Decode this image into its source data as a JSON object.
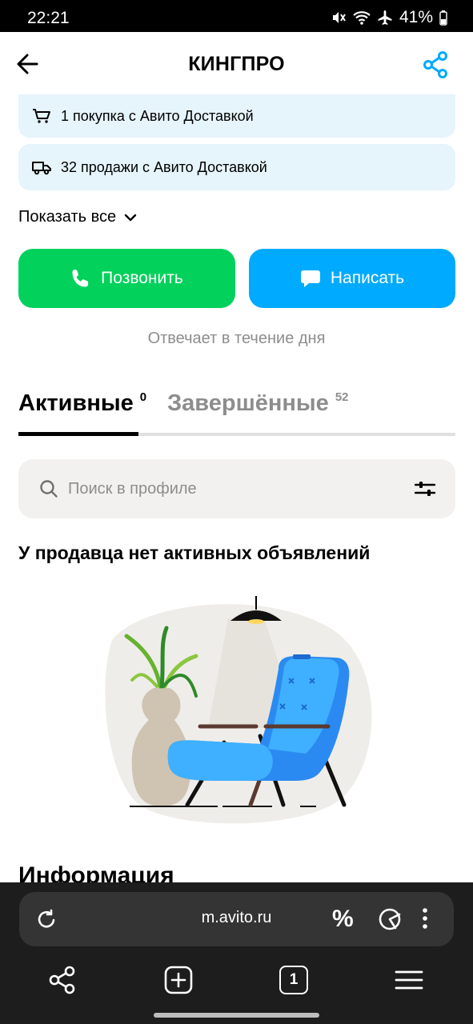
{
  "status": {
    "time": "22:21",
    "battery": "41%"
  },
  "header": {
    "title": "КИНГПРО"
  },
  "cards": [
    {
      "icon": "cart-icon",
      "text": "1 покупка с Авито Доставкой"
    },
    {
      "icon": "truck-icon",
      "text": "32 продажи с Авито Доставкой"
    }
  ],
  "show_all": "Показать все",
  "actions": {
    "call_label": "Позвонить",
    "message_label": "Написать",
    "call_color": "#02d15c",
    "message_color": "#00aaff"
  },
  "response_time": "Отвечает в течение дня",
  "tabs": [
    {
      "label": "Активные",
      "count": "0"
    },
    {
      "label": "Завершённые",
      "count": "52"
    }
  ],
  "search": {
    "placeholder": "Поиск в профиле"
  },
  "empty_state": "У продавца нет активных объявлений",
  "info_heading": "Информация",
  "browser": {
    "url": "m.avito.ru",
    "tab_count": "1"
  }
}
